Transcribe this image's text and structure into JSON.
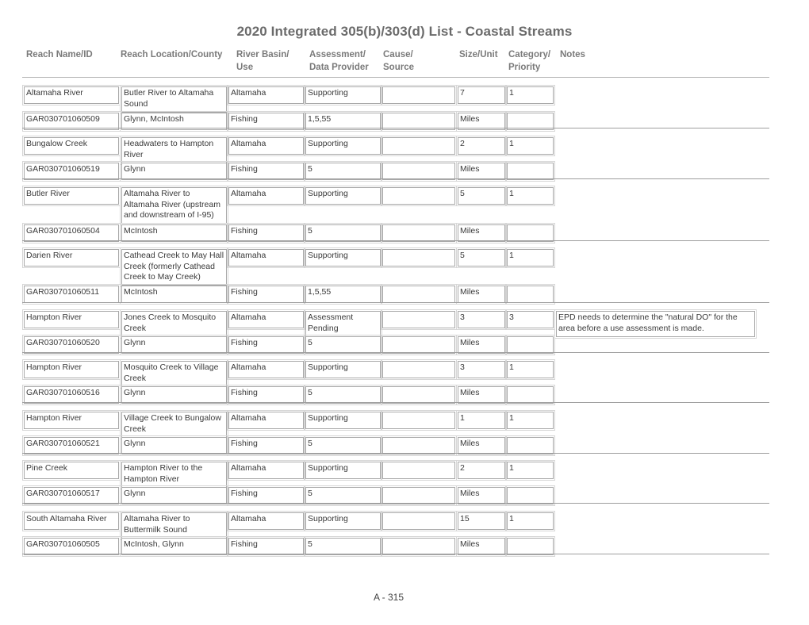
{
  "title": "2020 Integrated 305(b)/303(d) List - Coastal Streams",
  "headers": {
    "reach_name": "Reach Name/ID",
    "reach_location": "Reach Location/County",
    "river_basin_1": "River Basin/",
    "river_basin_2": "Use",
    "assessment_1": "Assessment/",
    "assessment_2": "Data Provider",
    "cause_1": "Cause/",
    "cause_2": "Source",
    "size_unit": "Size/Unit",
    "category_1": "Category/",
    "category_2": "Priority",
    "notes": "Notes"
  },
  "records": [
    {
      "name": "Altamaha River",
      "id": "GAR030701060509",
      "location": "Butler River to Altamaha Sound",
      "county": "Glynn, McIntosh",
      "basin": "Altamaha",
      "use": "Fishing",
      "assessment": "Supporting",
      "data_provider": "1,5,55",
      "cause": "",
      "source": "",
      "size": "7",
      "unit": "Miles",
      "category": "1",
      "priority": "",
      "notes": ""
    },
    {
      "name": "Bungalow Creek",
      "id": "GAR030701060519",
      "location": "Headwaters to Hampton River",
      "county": "Glynn",
      "basin": "Altamaha",
      "use": "Fishing",
      "assessment": "Supporting",
      "data_provider": "5",
      "cause": "",
      "source": "",
      "size": "2",
      "unit": "Miles",
      "category": "1",
      "priority": "",
      "notes": ""
    },
    {
      "name": "Butler River",
      "id": "GAR030701060504",
      "location": "Altamaha River to Altamaha River (upstream and downstream of I-95)",
      "county": "McIntosh",
      "basin": "Altamaha",
      "use": "Fishing",
      "assessment": "Supporting",
      "data_provider": "5",
      "cause": "",
      "source": "",
      "size": "5",
      "unit": "Miles",
      "category": "1",
      "priority": "",
      "notes": ""
    },
    {
      "name": "Darien River",
      "id": "GAR030701060511",
      "location": "Cathead Creek to May Hall Creek (formerly Cathead Creek to May Creek)",
      "county": "McIntosh",
      "basin": "Altamaha",
      "use": "Fishing",
      "assessment": "Supporting",
      "data_provider": "1,5,55",
      "cause": "",
      "source": "",
      "size": "5",
      "unit": "Miles",
      "category": "1",
      "priority": "",
      "notes": ""
    },
    {
      "name": "Hampton River",
      "id": "GAR030701060520",
      "location": "Jones Creek to Mosquito Creek",
      "county": "Glynn",
      "basin": "Altamaha",
      "use": "Fishing",
      "assessment": "Assessment Pending",
      "data_provider": "5",
      "cause": "",
      "source": "",
      "size": "3",
      "unit": "Miles",
      "category": "3",
      "priority": "",
      "notes": "EPD needs to determine the \"natural DO\" for the area before a use assessment is made."
    },
    {
      "name": "Hampton River",
      "id": "GAR030701060516",
      "location": "Mosquito Creek to Village Creek",
      "county": "Glynn",
      "basin": "Altamaha",
      "use": "Fishing",
      "assessment": "Supporting",
      "data_provider": "5",
      "cause": "",
      "source": "",
      "size": "3",
      "unit": "Miles",
      "category": "1",
      "priority": "",
      "notes": ""
    },
    {
      "name": "Hampton River",
      "id": "GAR030701060521",
      "location": "Village Creek to Bungalow Creek",
      "county": "Glynn",
      "basin": "Altamaha",
      "use": "Fishing",
      "assessment": "Supporting",
      "data_provider": "5",
      "cause": "",
      "source": "",
      "size": "1",
      "unit": "Miles",
      "category": "1",
      "priority": "",
      "notes": ""
    },
    {
      "name": "Pine Creek",
      "id": "GAR030701060517",
      "location": "Hampton River to the Hampton River",
      "county": "Glynn",
      "basin": "Altamaha",
      "use": "Fishing",
      "assessment": "Supporting",
      "data_provider": "5",
      "cause": "",
      "source": "",
      "size": "2",
      "unit": "Miles",
      "category": "1",
      "priority": "",
      "notes": ""
    },
    {
      "name": "South Altamaha River",
      "id": "GAR030701060505",
      "location": "Altamaha River to Buttermilk Sound",
      "county": "McIntosh, Glynn",
      "basin": "Altamaha",
      "use": "Fishing",
      "assessment": "Supporting",
      "data_provider": "5",
      "cause": "",
      "source": "",
      "size": "15",
      "unit": "Miles",
      "category": "1",
      "priority": "",
      "notes": ""
    }
  ],
  "footer": {
    "page_number": "A - 315"
  }
}
